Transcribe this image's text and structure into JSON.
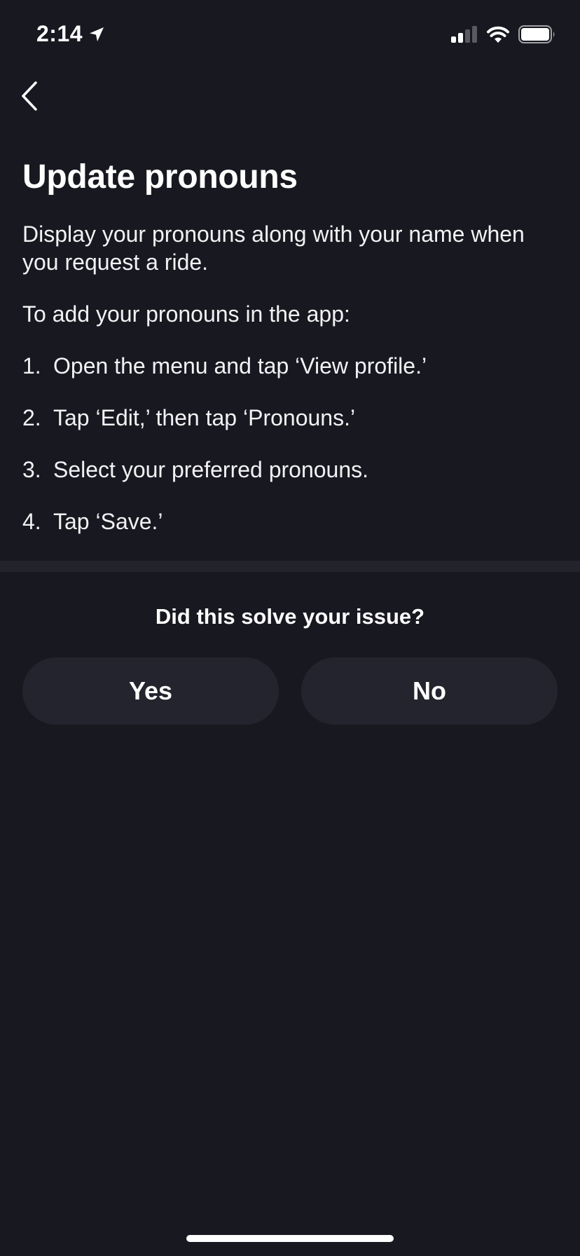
{
  "status_bar": {
    "time": "2:14",
    "location_icon": "location-arrow-icon",
    "signal_icon": "cellular-signal-icon",
    "wifi_icon": "wifi-icon",
    "battery_icon": "battery-icon"
  },
  "nav": {
    "back_icon": "chevron-left-icon"
  },
  "article": {
    "title": "Update pronouns",
    "intro": "Display your pronouns along with your name when you request a ride.",
    "lead": "To add your pronouns in the app:",
    "steps": [
      {
        "num": "1.",
        "text": "Open the menu and tap ‘View profile.’"
      },
      {
        "num": "2.",
        "text": "Tap ‘Edit,’ then tap ‘Pronouns.’"
      },
      {
        "num": "3.",
        "text": "Select your preferred pronouns."
      },
      {
        "num": "4.",
        "text": "Tap ‘Save.’"
      }
    ]
  },
  "feedback": {
    "question": "Did this solve your issue?",
    "yes_label": "Yes",
    "no_label": "No"
  },
  "colors": {
    "background": "#181820",
    "button_bg": "#24242e",
    "divider": "#23232c",
    "text": "#ffffff"
  }
}
